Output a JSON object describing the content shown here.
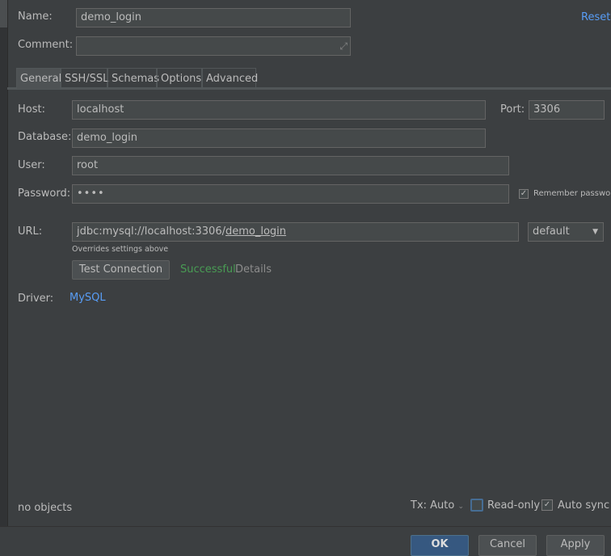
{
  "name": {
    "label": "Name:",
    "value": "demo_login"
  },
  "comment": {
    "label": "Comment:",
    "value": ""
  },
  "reset_label": "Reset",
  "tabs": [
    {
      "label": "General",
      "active": true
    },
    {
      "label": "SSH/SSL",
      "active": false
    },
    {
      "label": "Schemas",
      "active": false
    },
    {
      "label": "Options",
      "active": false
    },
    {
      "label": "Advanced",
      "active": false
    }
  ],
  "host": {
    "label": "Host:",
    "value": "localhost"
  },
  "port": {
    "label": "Port:",
    "value": "3306"
  },
  "database": {
    "label": "Database:",
    "value": "demo_login"
  },
  "user": {
    "label": "User:",
    "value": "root"
  },
  "password": {
    "label": "Password:",
    "value": "••••"
  },
  "remember_password": {
    "label": "Remember password",
    "checked": true
  },
  "url": {
    "label": "URL:",
    "prefix": "jdbc:mysql://localhost:3306/",
    "db": "demo_login",
    "mode": "default"
  },
  "overrides_note": "Overrides settings above",
  "test_connection": {
    "label": "Test Connection",
    "status": "Successful",
    "details": "Details"
  },
  "driver": {
    "label": "Driver:",
    "value": "MySQL"
  },
  "status_bar": {
    "objects": "no objects",
    "tx": "Tx: Auto",
    "read_only": {
      "label": "Read-only",
      "checked": false
    },
    "auto_sync": {
      "label": "Auto sync",
      "checked": true
    }
  },
  "buttons": {
    "ok": "OK",
    "cancel": "Cancel",
    "apply": "Apply"
  },
  "colors": {
    "background": "#3c3f41",
    "link": "#589df6",
    "success": "#499c54",
    "ok_button": "#365880"
  }
}
